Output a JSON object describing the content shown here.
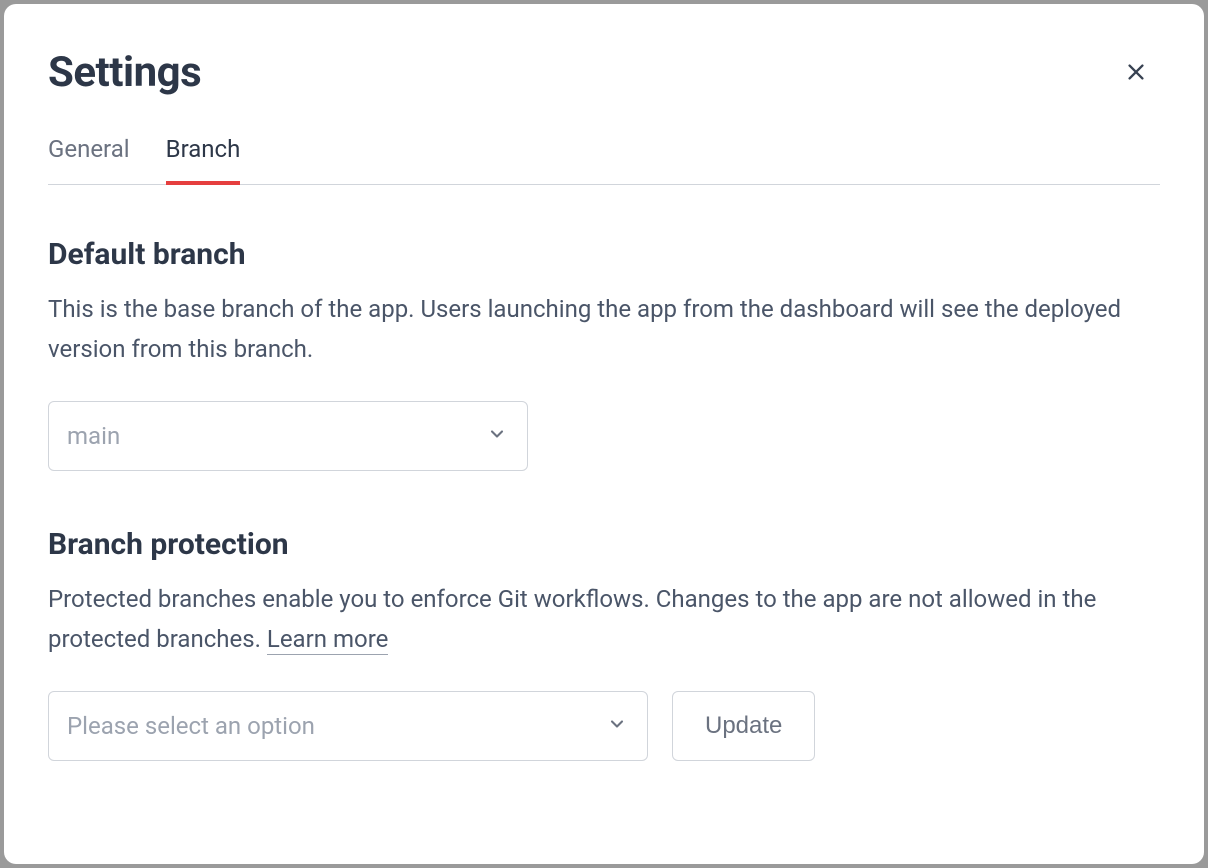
{
  "title": "Settings",
  "tabs": [
    {
      "label": "General",
      "active": false
    },
    {
      "label": "Branch",
      "active": true
    }
  ],
  "sections": {
    "default_branch": {
      "heading": "Default branch",
      "description": "This is the base branch of the app. Users launching the app from the dashboard will see the deployed version from this branch.",
      "select_value": "main"
    },
    "branch_protection": {
      "heading": "Branch protection",
      "description_prefix": "Protected branches enable you to enforce Git workflows. Changes to the app are not allowed in the protected branches. ",
      "learn_more": "Learn more",
      "select_placeholder": "Please select an option",
      "update_button": "Update"
    }
  }
}
